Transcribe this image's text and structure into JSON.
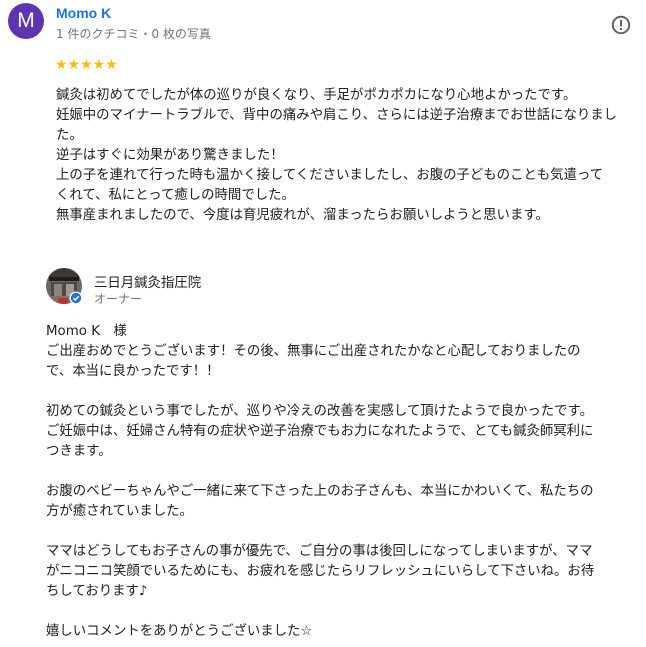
{
  "review": {
    "avatar_letter": "M",
    "avatar_color": "#5e35b1",
    "reviewer_name": "Momo K",
    "reviewer_meta": "1 件のクチコミ・0 枚の写真",
    "rating_stars": 5,
    "stars_text": "★★★★★",
    "report_icon": "report-flag-icon",
    "lines": [
      "鍼灸は初めてでしたが体の巡りが良くなり、手足がポカポカになり心地よかったです。",
      "妊娠中のマイナートラブルで、背中の痛みや肩こり、さらには逆子治療までお世話になりまし",
      "た。",
      "逆子はすぐに効果があり驚きました！",
      "上の子を連れて行った時も温かく接してくださいましたし、お腹の子どものことも気遣って",
      "くれて、私にとって癒しの時間でした。",
      "無事産まれましたので、今度は育児疲れが、溜まったらお願いしようと思います。"
    ]
  },
  "owner_reply": {
    "owner_name": "三日月鍼灸指圧院",
    "owner_role": "オーナー",
    "verified_icon": "verified-check-icon",
    "paragraphs": [
      [
        "Momo K　様",
        "ご出産おめでとうございます！その後、無事にご出産されたかなと心配しておりましたの",
        "で、本当に良かったです！！"
      ],
      [
        "初めての鍼灸という事でしたが、巡りや冷えの改善を実感して頂けたようで良かったです。",
        "ご妊娠中は、妊婦さん特有の症状や逆子治療でもお力になれたようで、とても鍼灸師冥利に",
        "つきます。"
      ],
      [
        "お腹のベビーちゃんやご一緒に来て下さった上のお子さんも、本当にかわいくて、私たちの",
        "方が癒されていました。"
      ],
      [
        "ママはどうしてもお子さんの事が優先で、ご自分の事は後回しになってしまいますが、ママ",
        "がニコニコ笑顔でいるためにも、お疲れを感じたらリフレッシュにいらして下さいね。お待",
        "ちしております♪"
      ],
      [
        "嬉しいコメントをありがとうございました☆"
      ]
    ]
  }
}
